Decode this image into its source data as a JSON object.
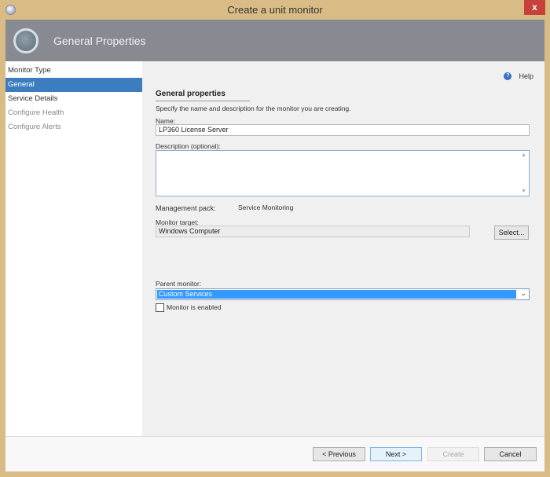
{
  "window": {
    "title": "Create a unit monitor",
    "close": "x"
  },
  "header": {
    "title": "General Properties"
  },
  "sidebar": {
    "items": [
      {
        "label": "Monitor Type"
      },
      {
        "label": "General"
      },
      {
        "label": "Service Details"
      },
      {
        "label": "Configure Health"
      },
      {
        "label": "Configure Alerts"
      }
    ]
  },
  "main": {
    "help": "Help",
    "help_icon": "?",
    "section_title": "General properties",
    "intro": "Specify the name and description for the monitor you are creating.",
    "name_label": "Name:",
    "name_value": "LP360 License Server",
    "description_label": "Description (optional):",
    "description_value": "",
    "mp_label": "Management pack:",
    "mp_value": "Service Monitoring",
    "target_label": "Monitor target:",
    "target_value": "Windows Computer",
    "select_btn": "Select...",
    "parent_label": "Parent monitor:",
    "parent_value": "Custom Services",
    "enabled_label": "Monitor is enabled",
    "enabled_checked": false
  },
  "footer": {
    "previous": "< Previous",
    "next": "Next >",
    "create": "Create",
    "cancel": "Cancel"
  }
}
